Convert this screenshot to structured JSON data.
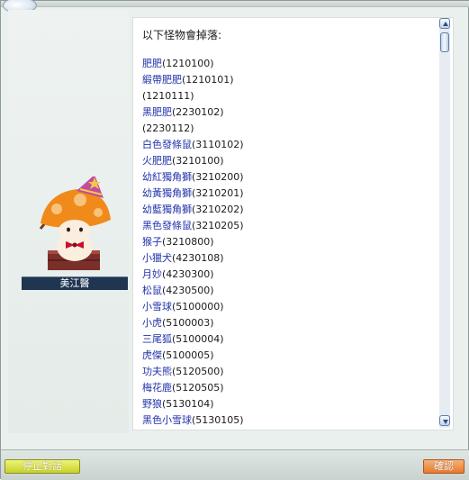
{
  "dialog": {
    "npc": {
      "name": "美江醫"
    },
    "header": "以下怪物會掉落:",
    "monsters": [
      {
        "name": "肥肥",
        "id": "(1210100)"
      },
      {
        "name": "緞帶肥肥",
        "id": "(1210101)"
      },
      {
        "name": "",
        "id": "(1210111)"
      },
      {
        "name": "黑肥肥",
        "id": "(2230102)"
      },
      {
        "name": "",
        "id": "(2230112)"
      },
      {
        "name": "白色發條鼠",
        "id": "(3110102)"
      },
      {
        "name": "火肥肥",
        "id": "(3210100)"
      },
      {
        "name": "幼紅獨角獅",
        "id": "(3210200)"
      },
      {
        "name": "幼黃獨角獅",
        "id": "(3210201)"
      },
      {
        "name": "幼藍獨角獅",
        "id": "(3210202)"
      },
      {
        "name": "黑色發條鼠",
        "id": "(3210205)"
      },
      {
        "name": "猴子",
        "id": "(3210800)"
      },
      {
        "name": "小獵犬",
        "id": "(4230108)"
      },
      {
        "name": "月妙",
        "id": "(4230300)"
      },
      {
        "name": "松鼠",
        "id": "(4230500)"
      },
      {
        "name": "小雪球",
        "id": "(5100000)"
      },
      {
        "name": "小虎",
        "id": "(5100003)"
      },
      {
        "name": "三尾狐",
        "id": "(5100004)"
      },
      {
        "name": "虎傑",
        "id": "(5100005)"
      },
      {
        "name": "功夫熊",
        "id": "(5120500)"
      },
      {
        "name": "梅花鹿",
        "id": "(5120505)"
      },
      {
        "name": "野狼",
        "id": "(5130104)"
      },
      {
        "name": "黑色小雪球",
        "id": "(5130105)"
      }
    ],
    "buttons": {
      "stop": "停止對話",
      "ok": "確認"
    }
  },
  "icons": {
    "scroll_up": "arrow-up-icon",
    "scroll_down": "arrow-down-icon",
    "npc_art": "mushroom-wizard-npc"
  },
  "colors": {
    "monster_name": "#2233aa",
    "stop_button": "#c7d12a",
    "ok_button": "#e7792c",
    "name_tag": "#1f3550"
  }
}
